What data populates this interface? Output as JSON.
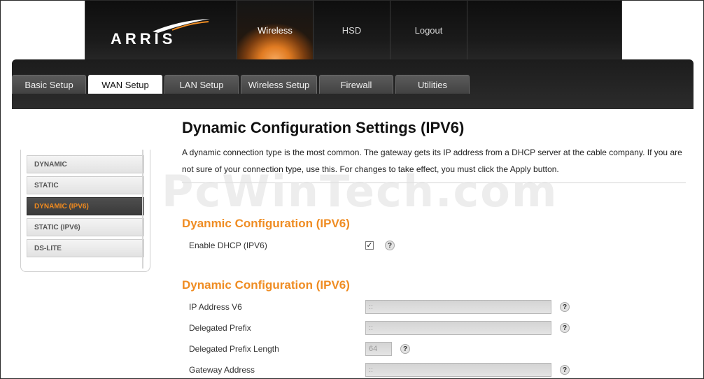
{
  "brand": {
    "logo_text": "ARRIS"
  },
  "topnav": [
    {
      "label": "Wireless",
      "active": true
    },
    {
      "label": "HSD",
      "active": false
    },
    {
      "label": "Logout",
      "active": false
    }
  ],
  "tabs": [
    {
      "label": "Basic Setup",
      "active": false
    },
    {
      "label": "WAN Setup",
      "active": true
    },
    {
      "label": "LAN Setup",
      "active": false
    },
    {
      "label": "Wireless Setup",
      "active": false
    },
    {
      "label": "Firewall",
      "active": false
    },
    {
      "label": "Utilities",
      "active": false
    }
  ],
  "sidebar": {
    "items": [
      {
        "label": "DYNAMIC",
        "active": false
      },
      {
        "label": "STATIC",
        "active": false
      },
      {
        "label": "DYNAMIC (IPV6)",
        "active": true
      },
      {
        "label": "STATIC (IPV6)",
        "active": false
      },
      {
        "label": "DS-LITE",
        "active": false
      }
    ]
  },
  "main": {
    "title": "Dynamic Configuration Settings (IPV6)",
    "description": "A dynamic connection type is the most common. The gateway gets its IP address from a DHCP server at the cable company. If you are not sure of your connection type, use this. For changes to take effect, you must click the Apply button.",
    "section1": {
      "title": "Dyanmic Configuration (IPV6)",
      "enable_dhcp_label": "Enable DHCP (IPV6)",
      "enable_dhcp_checked": true,
      "check_glyph": "✓"
    },
    "section2": {
      "title": "Dynamic Configuration (IPV6)",
      "fields": {
        "ip_address_v6": {
          "label": "IP Address V6",
          "value": "::"
        },
        "delegated_prefix": {
          "label": "Delegated Prefix",
          "value": "::"
        },
        "delegated_prefix_length": {
          "label": "Delegated Prefix Length",
          "value": "64"
        },
        "gateway_address": {
          "label": "Gateway Address",
          "value": "::"
        }
      }
    },
    "help_glyph": "?"
  },
  "watermark": "PcWinTech.com",
  "colors": {
    "accent": "#ef8c22",
    "header_bg": "#151515",
    "active_tab": "#ffffff"
  }
}
